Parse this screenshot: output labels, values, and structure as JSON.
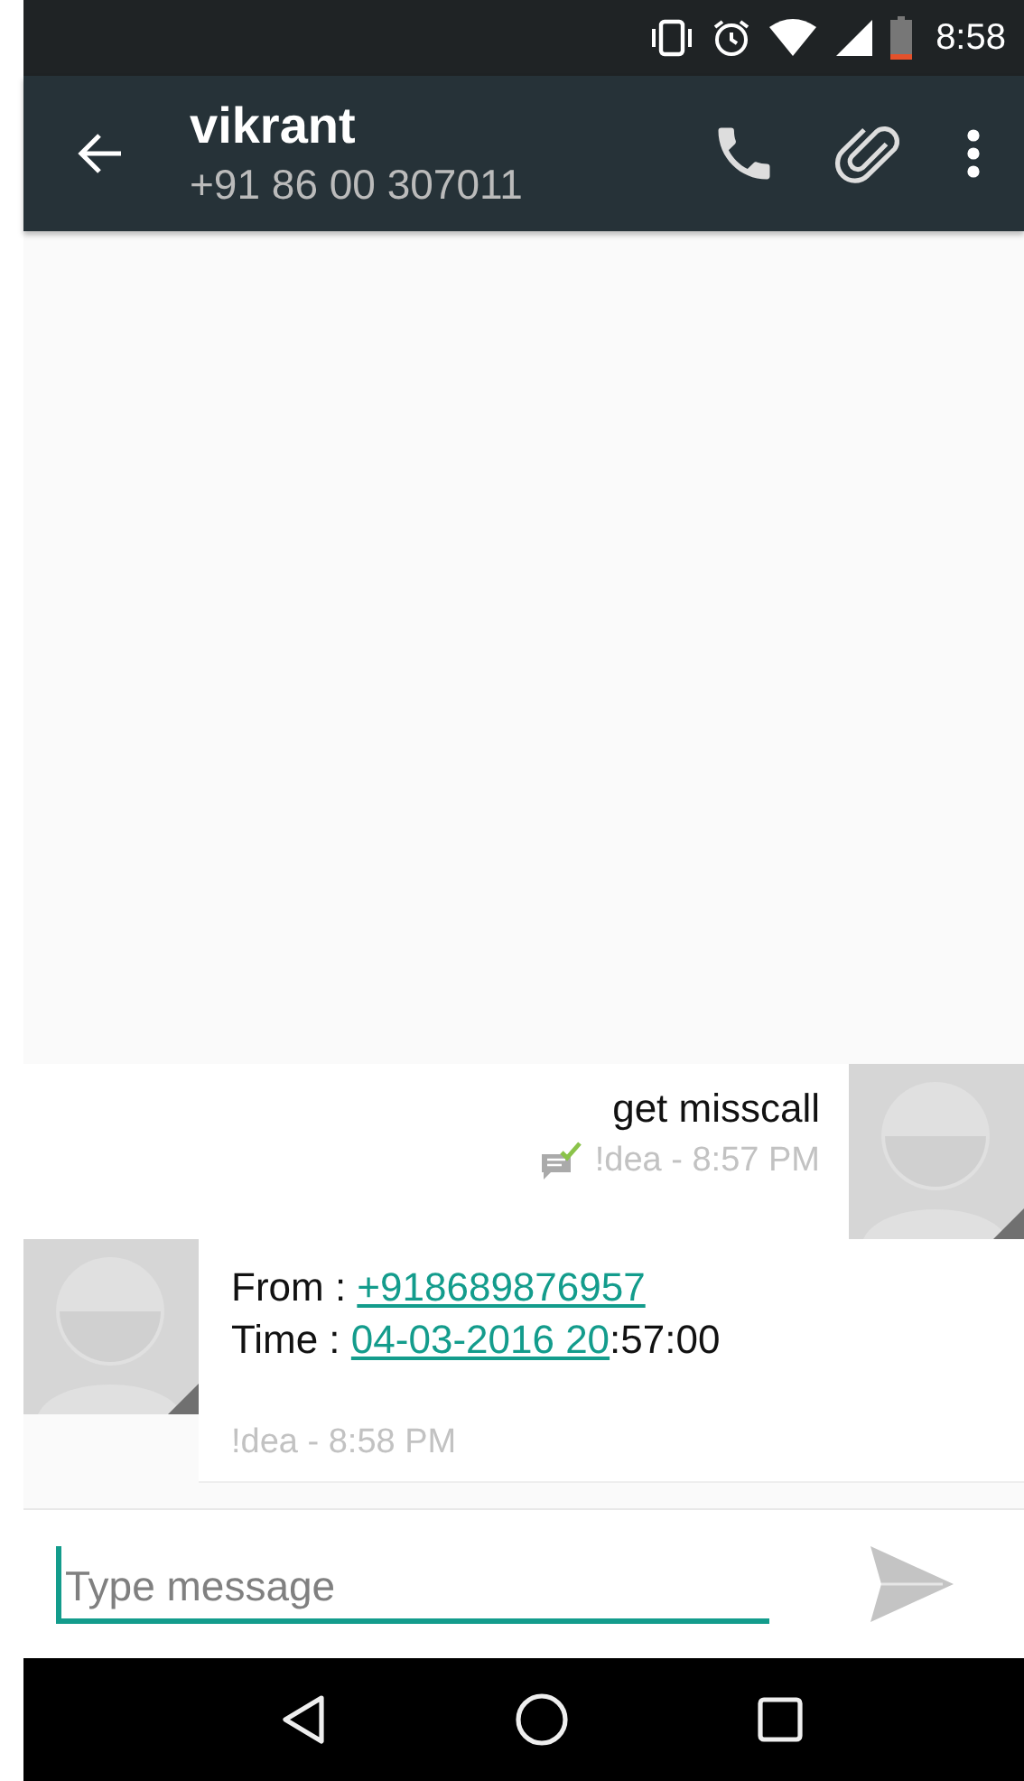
{
  "status_bar": {
    "time": "8:58"
  },
  "toolbar": {
    "title": "vikrant",
    "subtitle": "+91 86 00 307011"
  },
  "messages": [
    {
      "kind": "sent",
      "lines": [
        [
          {
            "text": "get misscall",
            "link": false
          }
        ]
      ],
      "delivered": true,
      "meta": "!dea - 8:57 PM"
    },
    {
      "kind": "received",
      "lines": [
        [
          {
            "text": "From :  ",
            "link": false
          },
          {
            "text": "+918689876957",
            "link": true
          }
        ],
        [
          {
            "text": "Time : ",
            "link": false
          },
          {
            "text": "04-03-2016 20",
            "link": true
          },
          {
            "text": ":57:00",
            "link": false
          }
        ]
      ],
      "meta": "!dea - 8:58 PM"
    }
  ],
  "composer": {
    "placeholder": "Type message"
  }
}
